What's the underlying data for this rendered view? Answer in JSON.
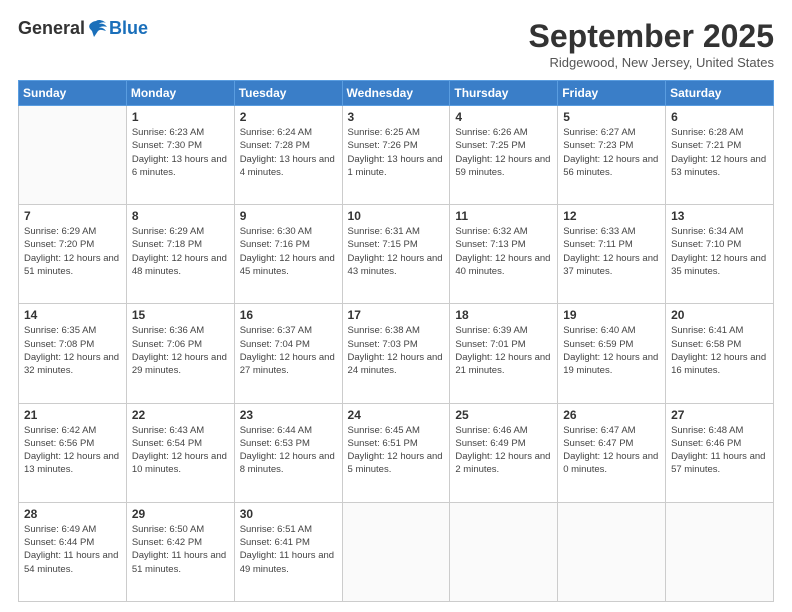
{
  "header": {
    "logo_general": "General",
    "logo_blue": "Blue",
    "month_title": "September 2025",
    "location": "Ridgewood, New Jersey, United States"
  },
  "weekdays": [
    "Sunday",
    "Monday",
    "Tuesday",
    "Wednesday",
    "Thursday",
    "Friday",
    "Saturday"
  ],
  "weeks": [
    [
      {
        "day": "",
        "sunrise": "",
        "sunset": "",
        "daylight": ""
      },
      {
        "day": "1",
        "sunrise": "Sunrise: 6:23 AM",
        "sunset": "Sunset: 7:30 PM",
        "daylight": "Daylight: 13 hours and 6 minutes."
      },
      {
        "day": "2",
        "sunrise": "Sunrise: 6:24 AM",
        "sunset": "Sunset: 7:28 PM",
        "daylight": "Daylight: 13 hours and 4 minutes."
      },
      {
        "day": "3",
        "sunrise": "Sunrise: 6:25 AM",
        "sunset": "Sunset: 7:26 PM",
        "daylight": "Daylight: 13 hours and 1 minute."
      },
      {
        "day": "4",
        "sunrise": "Sunrise: 6:26 AM",
        "sunset": "Sunset: 7:25 PM",
        "daylight": "Daylight: 12 hours and 59 minutes."
      },
      {
        "day": "5",
        "sunrise": "Sunrise: 6:27 AM",
        "sunset": "Sunset: 7:23 PM",
        "daylight": "Daylight: 12 hours and 56 minutes."
      },
      {
        "day": "6",
        "sunrise": "Sunrise: 6:28 AM",
        "sunset": "Sunset: 7:21 PM",
        "daylight": "Daylight: 12 hours and 53 minutes."
      }
    ],
    [
      {
        "day": "7",
        "sunrise": "Sunrise: 6:29 AM",
        "sunset": "Sunset: 7:20 PM",
        "daylight": "Daylight: 12 hours and 51 minutes."
      },
      {
        "day": "8",
        "sunrise": "Sunrise: 6:29 AM",
        "sunset": "Sunset: 7:18 PM",
        "daylight": "Daylight: 12 hours and 48 minutes."
      },
      {
        "day": "9",
        "sunrise": "Sunrise: 6:30 AM",
        "sunset": "Sunset: 7:16 PM",
        "daylight": "Daylight: 12 hours and 45 minutes."
      },
      {
        "day": "10",
        "sunrise": "Sunrise: 6:31 AM",
        "sunset": "Sunset: 7:15 PM",
        "daylight": "Daylight: 12 hours and 43 minutes."
      },
      {
        "day": "11",
        "sunrise": "Sunrise: 6:32 AM",
        "sunset": "Sunset: 7:13 PM",
        "daylight": "Daylight: 12 hours and 40 minutes."
      },
      {
        "day": "12",
        "sunrise": "Sunrise: 6:33 AM",
        "sunset": "Sunset: 7:11 PM",
        "daylight": "Daylight: 12 hours and 37 minutes."
      },
      {
        "day": "13",
        "sunrise": "Sunrise: 6:34 AM",
        "sunset": "Sunset: 7:10 PM",
        "daylight": "Daylight: 12 hours and 35 minutes."
      }
    ],
    [
      {
        "day": "14",
        "sunrise": "Sunrise: 6:35 AM",
        "sunset": "Sunset: 7:08 PM",
        "daylight": "Daylight: 12 hours and 32 minutes."
      },
      {
        "day": "15",
        "sunrise": "Sunrise: 6:36 AM",
        "sunset": "Sunset: 7:06 PM",
        "daylight": "Daylight: 12 hours and 29 minutes."
      },
      {
        "day": "16",
        "sunrise": "Sunrise: 6:37 AM",
        "sunset": "Sunset: 7:04 PM",
        "daylight": "Daylight: 12 hours and 27 minutes."
      },
      {
        "day": "17",
        "sunrise": "Sunrise: 6:38 AM",
        "sunset": "Sunset: 7:03 PM",
        "daylight": "Daylight: 12 hours and 24 minutes."
      },
      {
        "day": "18",
        "sunrise": "Sunrise: 6:39 AM",
        "sunset": "Sunset: 7:01 PM",
        "daylight": "Daylight: 12 hours and 21 minutes."
      },
      {
        "day": "19",
        "sunrise": "Sunrise: 6:40 AM",
        "sunset": "Sunset: 6:59 PM",
        "daylight": "Daylight: 12 hours and 19 minutes."
      },
      {
        "day": "20",
        "sunrise": "Sunrise: 6:41 AM",
        "sunset": "Sunset: 6:58 PM",
        "daylight": "Daylight: 12 hours and 16 minutes."
      }
    ],
    [
      {
        "day": "21",
        "sunrise": "Sunrise: 6:42 AM",
        "sunset": "Sunset: 6:56 PM",
        "daylight": "Daylight: 12 hours and 13 minutes."
      },
      {
        "day": "22",
        "sunrise": "Sunrise: 6:43 AM",
        "sunset": "Sunset: 6:54 PM",
        "daylight": "Daylight: 12 hours and 10 minutes."
      },
      {
        "day": "23",
        "sunrise": "Sunrise: 6:44 AM",
        "sunset": "Sunset: 6:53 PM",
        "daylight": "Daylight: 12 hours and 8 minutes."
      },
      {
        "day": "24",
        "sunrise": "Sunrise: 6:45 AM",
        "sunset": "Sunset: 6:51 PM",
        "daylight": "Daylight: 12 hours and 5 minutes."
      },
      {
        "day": "25",
        "sunrise": "Sunrise: 6:46 AM",
        "sunset": "Sunset: 6:49 PM",
        "daylight": "Daylight: 12 hours and 2 minutes."
      },
      {
        "day": "26",
        "sunrise": "Sunrise: 6:47 AM",
        "sunset": "Sunset: 6:47 PM",
        "daylight": "Daylight: 12 hours and 0 minutes."
      },
      {
        "day": "27",
        "sunrise": "Sunrise: 6:48 AM",
        "sunset": "Sunset: 6:46 PM",
        "daylight": "Daylight: 11 hours and 57 minutes."
      }
    ],
    [
      {
        "day": "28",
        "sunrise": "Sunrise: 6:49 AM",
        "sunset": "Sunset: 6:44 PM",
        "daylight": "Daylight: 11 hours and 54 minutes."
      },
      {
        "day": "29",
        "sunrise": "Sunrise: 6:50 AM",
        "sunset": "Sunset: 6:42 PM",
        "daylight": "Daylight: 11 hours and 51 minutes."
      },
      {
        "day": "30",
        "sunrise": "Sunrise: 6:51 AM",
        "sunset": "Sunset: 6:41 PM",
        "daylight": "Daylight: 11 hours and 49 minutes."
      },
      {
        "day": "",
        "sunrise": "",
        "sunset": "",
        "daylight": ""
      },
      {
        "day": "",
        "sunrise": "",
        "sunset": "",
        "daylight": ""
      },
      {
        "day": "",
        "sunrise": "",
        "sunset": "",
        "daylight": ""
      },
      {
        "day": "",
        "sunrise": "",
        "sunset": "",
        "daylight": ""
      }
    ]
  ]
}
